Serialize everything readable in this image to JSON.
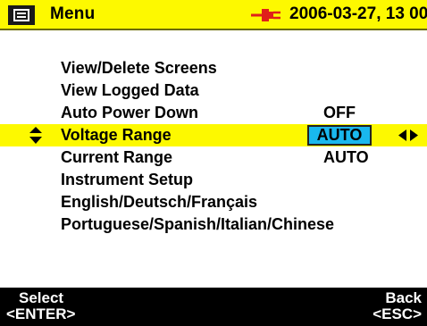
{
  "header": {
    "icon": "menu-icon",
    "title": "Menu",
    "status_icon": "power-plug-icon",
    "datetime": "2006-03-27, 13 00"
  },
  "menu": {
    "items": [
      {
        "label": "View/Delete Screens",
        "value": ""
      },
      {
        "label": "View Logged Data",
        "value": ""
      },
      {
        "label": "Auto Power Down",
        "value": "OFF"
      },
      {
        "label": "Voltage Range",
        "value": "AUTO",
        "selected": true
      },
      {
        "label": "Current Range",
        "value": "AUTO"
      },
      {
        "label": "Instrument Setup",
        "value": ""
      },
      {
        "label": "English/Deutsch/Français",
        "value": ""
      },
      {
        "label": "Portuguese/Spanish/Italian/Chinese",
        "value": ""
      }
    ],
    "selection_icons": [
      "up-down-arrows-icon",
      "left-right-arrows-icon"
    ]
  },
  "softkeys": {
    "left": {
      "caption": "Select",
      "key": "<ENTER>"
    },
    "right": {
      "caption": "Back",
      "key": "<ESC>"
    }
  },
  "colors": {
    "highlight": "#fdf900",
    "value_box": "#19b8ee",
    "footer": "#000000"
  }
}
